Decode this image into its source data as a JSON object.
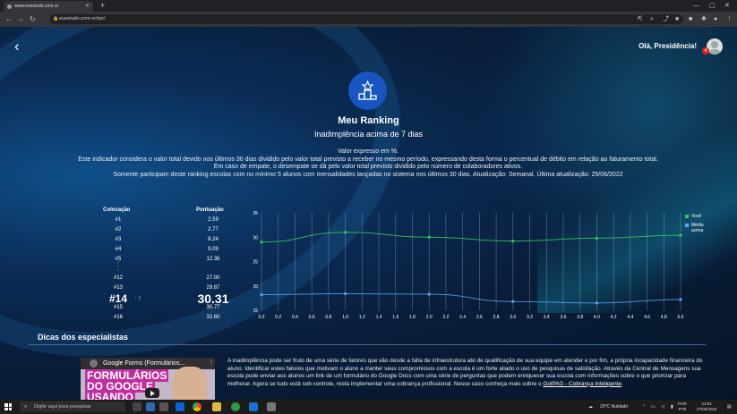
{
  "browser": {
    "tab_title": "www.euestudo.com.vc",
    "url": "euestudo.com.vc/ipc/"
  },
  "header": {
    "greeting": "Olá, Presidência!",
    "notification_count": "4"
  },
  "main": {
    "title": "Meu Ranking",
    "subtitle": "Inadimplência acima de 7 dias",
    "description": [
      "Valor expresso em %.",
      "Este indicador considera o valor total devido nos últimos 30 dias dividido pelo valor total previsto a receber no mesmo período, expressando desta forma o percentual de débito em relação ao faturamento total.",
      "Em caso de empate, o desempate se dá pelo valor total previsto dividido pelo número de colaboradores ativos.",
      "Somente participam deste ranking escolas com no mínimo 5 alunos com mensalidades lançadas no sistema nos últimos 30 dias. Atualização: Semanal. Última atualização: 25/06/2022"
    ]
  },
  "ranking": {
    "col_position": "Colocação",
    "col_score": "Pontuação",
    "rows": [
      {
        "pos": "#1",
        "score": "2.59"
      },
      {
        "pos": "#2",
        "score": "2.77"
      },
      {
        "pos": "#3",
        "score": "8.24"
      },
      {
        "pos": "#4",
        "score": "9.09"
      },
      {
        "pos": "#5",
        "score": "12.36"
      },
      {
        "pos": "#12",
        "score": "27.00"
      },
      {
        "pos": "#13",
        "score": "29.87"
      },
      {
        "pos": "#14",
        "score": "30.31",
        "change": "3"
      },
      {
        "pos": "#15",
        "score": "30.77"
      },
      {
        "pos": "#16",
        "score": "32.60"
      }
    ],
    "highlight_index": 7
  },
  "chart_data": {
    "type": "line",
    "x": [
      "0.0",
      "0.2",
      "0.4",
      "0.6",
      "0.8",
      "1.0",
      "1.2",
      "1.4",
      "1.6",
      "1.8",
      "2.0",
      "2.2",
      "2.4",
      "2.6",
      "2.8",
      "3.0",
      "3.2",
      "3.4",
      "3.6",
      "3.8",
      "4.0",
      "4.2",
      "4.4",
      "4.6",
      "4.8",
      "5.0"
    ],
    "yticks": [
      15,
      20,
      25,
      30,
      35
    ],
    "ylim": [
      15,
      35
    ],
    "xlim": [
      0,
      5
    ],
    "series": [
      {
        "name": "Você",
        "color": "#37c85a",
        "x": [
          0,
          1,
          2,
          3,
          4,
          5
        ],
        "values": [
          29.0,
          31.0,
          30.0,
          29.2,
          29.8,
          30.4
        ]
      },
      {
        "name": "Média acima",
        "color": "#5aa9f0",
        "x": [
          0,
          1,
          2,
          3,
          4,
          5
        ],
        "values": [
          18.2,
          18.4,
          18.3,
          16.8,
          16.5,
          17.2
        ]
      }
    ],
    "grid": true,
    "legend": "right"
  },
  "tips": {
    "heading": "Dicas dos especialistas",
    "video_title": "Google Forms (Formulários...",
    "video_text_1": "FORMULÁRIOS",
    "video_text_2": "DO GOOGLE",
    "video_text_3": "USANDO",
    "text": "A inadimplência pode ser fruto de uma série de fatores que vão desde a falta de infraestrutura até de qualificação de sua equipe em atender e por fim, a própria incapacidade financeira do aluno. Identificar estes fatores que motivam o aluno a manter seus compromissos com a escola é um forte aliado o uso de pesquisas de satisfação. Através da Central de Mensagens sua escola pode enviar aos alunos um link de um formulário do Google Docs com uma série de perguntas que podem enriquecer sua escola com informações sobre o que priorizar para melhorar. Agora se tudo está sob controle, resta implementar uma cobrança profissional. Nesse caso conheça mais sobre o ",
    "link": "GolPAG - Cobrança Inteligente",
    "text_end": "."
  },
  "taskbar": {
    "search_placeholder": "Digite aqui para pesquisar",
    "weather": "20°C  Nublado",
    "lang_1": "POR",
    "lang_2": "PTB",
    "time": "14:51",
    "date": "27/06/2022"
  }
}
